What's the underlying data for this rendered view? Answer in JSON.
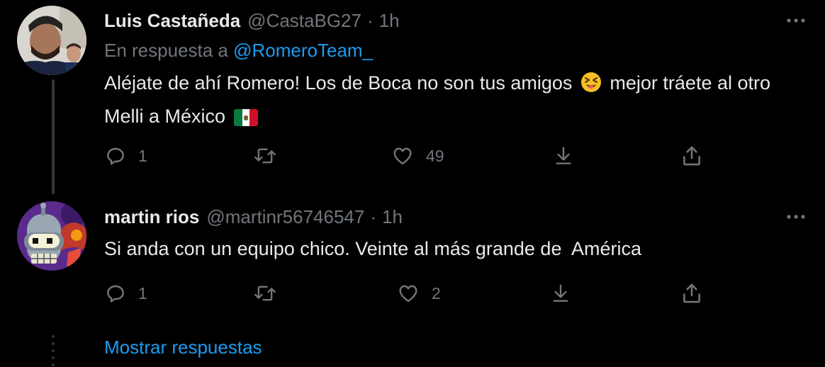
{
  "tweets": [
    {
      "name": "Luis Castañeda",
      "handle": "@CastaBG27",
      "separator": "·",
      "time": "1h",
      "reply_prefix": "En respuesta a ",
      "reply_to": "@RomeroTeam_",
      "text_part1": "Aléjate de ahí Romero! Los de Boca no son tus amigos ",
      "text_part2": " mejor tráete al otro Melli a México ",
      "emoji1": "squinting-face-with-tongue-icon",
      "emoji2": "mexico-flag-icon",
      "reply_count": "1",
      "retweet_count": "",
      "like_count": "49"
    },
    {
      "name": "martin rios",
      "handle": "@martinr56746547",
      "separator": "·",
      "time": "1h",
      "text": "Si anda con un equipo chico. Veinte al más grande de  América",
      "reply_count": "1",
      "retweet_count": "",
      "like_count": "2"
    }
  ],
  "show_replies_label": "Mostrar respuestas",
  "colors": {
    "background": "#000000",
    "text": "#e7e9ea",
    "secondary": "#71767b",
    "accent": "#1d9bf0",
    "thread_line": "#333639"
  }
}
